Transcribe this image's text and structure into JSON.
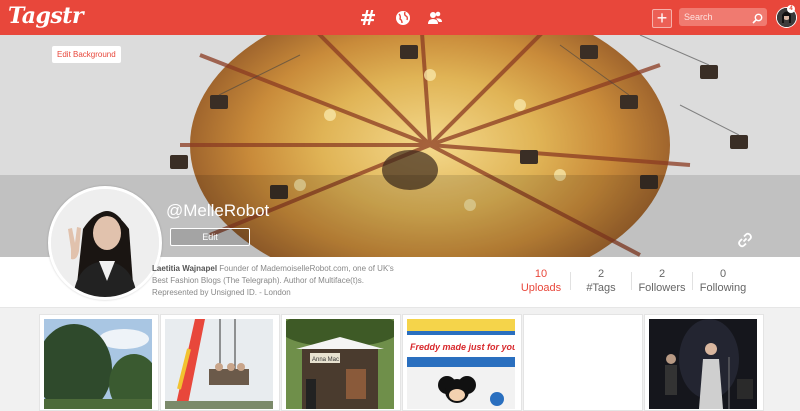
{
  "header": {
    "logo": "Tagstr",
    "search_placeholder": "Search",
    "notification_count": "4"
  },
  "banner": {
    "edit_background_label": "Edit Background"
  },
  "profile": {
    "username": "@MelleRobot",
    "edit_label": "Edit",
    "bio_name": "Laetitia Wajnapel",
    "bio_text": "Founder of MademoiselleRobot.com, one of UK's Best Fashion Blogs (The Telegraph). Author of Multiface(t)s. Represented by Unsigned ID. - London"
  },
  "stats": [
    {
      "value": "10",
      "label": "Uploads"
    },
    {
      "value": "2",
      "label": "#Tags"
    },
    {
      "value": "2",
      "label": "Followers"
    },
    {
      "value": "0",
      "label": "Following"
    }
  ],
  "colors": {
    "brand": "#e8473b",
    "background": "#f1f1f1"
  },
  "photo_overlays": {
    "bus_sign": "Freddy made just for you",
    "stall_sign": "Anna Mac"
  }
}
